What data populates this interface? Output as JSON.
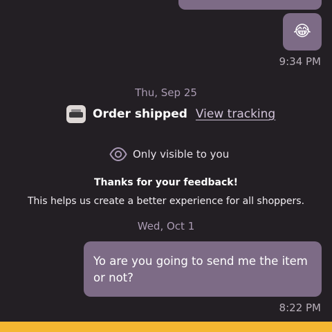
{
  "messages": {
    "emoji_message": "😂",
    "emoji_time": "9:34 PM",
    "text_message": "Yo are you going to send me the item or not?",
    "text_time": "8:22 PM"
  },
  "dates": {
    "first": "Thu, Sep 25",
    "second": "Wed, Oct 1"
  },
  "order": {
    "status_label": "Order shipped",
    "tracking_link": "View tracking",
    "thumbnail_icon": "product-thumbnail"
  },
  "system_notice": {
    "icon": "eye-icon",
    "visibility_text": "Only visible to you",
    "title": "Thanks for your feedback!",
    "body": "This helps us create a better experience for all shoppers."
  },
  "colors": {
    "background": "#231f24",
    "bubble": "#7d6b86",
    "date_text": "#aa9bb3",
    "bottom_bar": "#f5b731"
  }
}
